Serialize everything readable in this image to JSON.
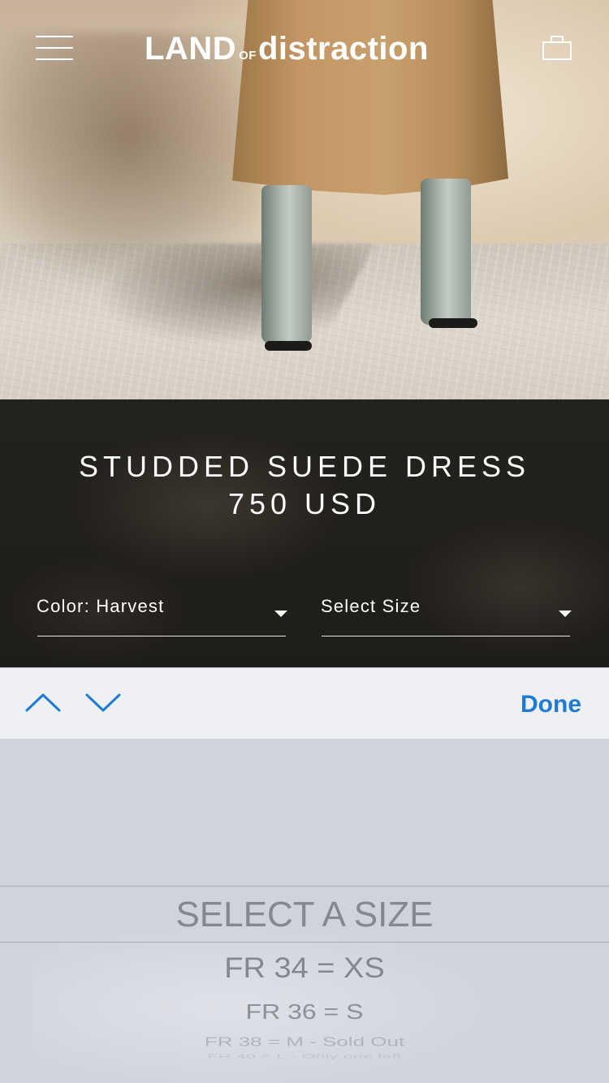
{
  "header": {
    "logo_land": "LAND",
    "logo_of": "OF",
    "logo_distraction": "distraction"
  },
  "product": {
    "title": "STUDDED SUEDE DRESS",
    "price": "750 USD"
  },
  "selects": {
    "color_label": "Color: Harvest",
    "size_label": "Select Size"
  },
  "accessory": {
    "done_label": "Done"
  },
  "picker": {
    "options": [
      "SELECT A SIZE",
      "FR 34 = XS",
      "FR 36 = S",
      "FR 38 = M - Sold Out",
      "FR 40 = L - Only one left"
    ],
    "selected": "SELECT A SIZE"
  },
  "colors": {
    "done_blue": "#1f7ad6",
    "product_panel_bg": "#221f1c",
    "picker_bg": "#d0d3da",
    "accessory_bg": "#eff0f3"
  },
  "icons": [
    "menu-icon",
    "shopping-bag-icon",
    "chevron-up-icon",
    "chevron-down-icon",
    "dropdown-arrow-icon"
  ]
}
